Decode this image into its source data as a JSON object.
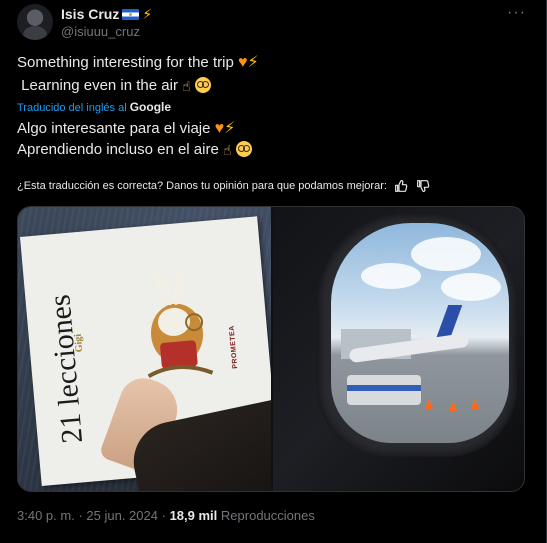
{
  "author": {
    "name": "Isis Cruz",
    "handle": "@isiuuu_cruz"
  },
  "icons": {
    "more": "more-dots-icon",
    "flag": "el-salvador-flag-icon",
    "bolt": "lightning-bolt-emoji",
    "heart": "orange-heart-emoji",
    "hand": "pointing-up-hand-emoji",
    "nerd": "nerd-face-emoji",
    "thumbs_up": "thumbs-up-icon",
    "thumbs_down": "thumbs-down-icon"
  },
  "tweet": {
    "line1": "Something interesting for the trip",
    "line2": "Learning even in the air",
    "translated_from": "Traducido del inglés al",
    "translator": "Google",
    "line3": "Algo interesante para el viaje",
    "line4": "Aprendiendo incluso en el aire",
    "feedback_question": "¿Esta traducción es correcta? Danos tu opinión para que podamos mejorar:"
  },
  "media": {
    "left": {
      "book_title": "21 lecciones",
      "book_author": "Gigi",
      "book_publisher": "PROMETEA"
    }
  },
  "footer": {
    "time": "3:40 p. m.",
    "sep": "·",
    "date": "25 jun. 2024",
    "views_count": "18,9 mil",
    "views_label": "Reproducciones"
  },
  "colors": {
    "background": "#000000",
    "text": "#e7e9ea",
    "secondary": "#71767b",
    "link": "#1d9bf0",
    "border": "#2f3336"
  }
}
